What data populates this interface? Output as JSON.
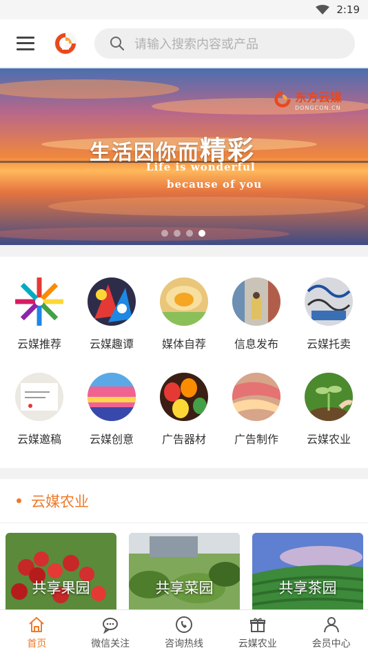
{
  "status_bar": {
    "time": "2:19"
  },
  "header": {
    "search_placeholder": "请输入搜索内容或产品"
  },
  "banner": {
    "brand_name": "东方云媒",
    "brand_domain": "DONGCON.CN",
    "slogan_main": "生活因你而",
    "slogan_big": "精彩",
    "slogan_en_line1": "Life is wonderful",
    "slogan_en_line2": "because of you",
    "slide_count": 4,
    "active_slide": 4
  },
  "categories": [
    {
      "label": "云媒推荐",
      "icon": "color-pencils-image"
    },
    {
      "label": "云媒趣谭",
      "icon": "colorful-art-image"
    },
    {
      "label": "媒体自荐",
      "icon": "flower-image"
    },
    {
      "label": "信息发布",
      "icon": "street-image"
    },
    {
      "label": "云媒托卖",
      "icon": "graffiti-image"
    },
    {
      "label": "云媒邀稿",
      "icon": "writing-image"
    },
    {
      "label": "云媒创意",
      "icon": "carousel-image"
    },
    {
      "label": "广告器材",
      "icon": "lanterns-image"
    },
    {
      "label": "广告制作",
      "icon": "fabric-image"
    },
    {
      "label": "云媒农业",
      "icon": "sprout-image"
    }
  ],
  "section": {
    "title": "云媒农业",
    "cards": [
      {
        "label": "共享果园"
      },
      {
        "label": "共享菜园"
      },
      {
        "label": "共享茶园"
      }
    ]
  },
  "bottom_nav": [
    {
      "label": "首页",
      "icon": "home-icon",
      "active": true
    },
    {
      "label": "微信关注",
      "icon": "chat-icon",
      "active": false
    },
    {
      "label": "咨询热线",
      "icon": "phone-icon",
      "active": false
    },
    {
      "label": "云媒农业",
      "icon": "gift-icon",
      "active": false
    },
    {
      "label": "会员中心",
      "icon": "user-icon",
      "active": false
    }
  ],
  "colors": {
    "accent": "#ef7a2b",
    "brand_red": "#e8491d"
  }
}
